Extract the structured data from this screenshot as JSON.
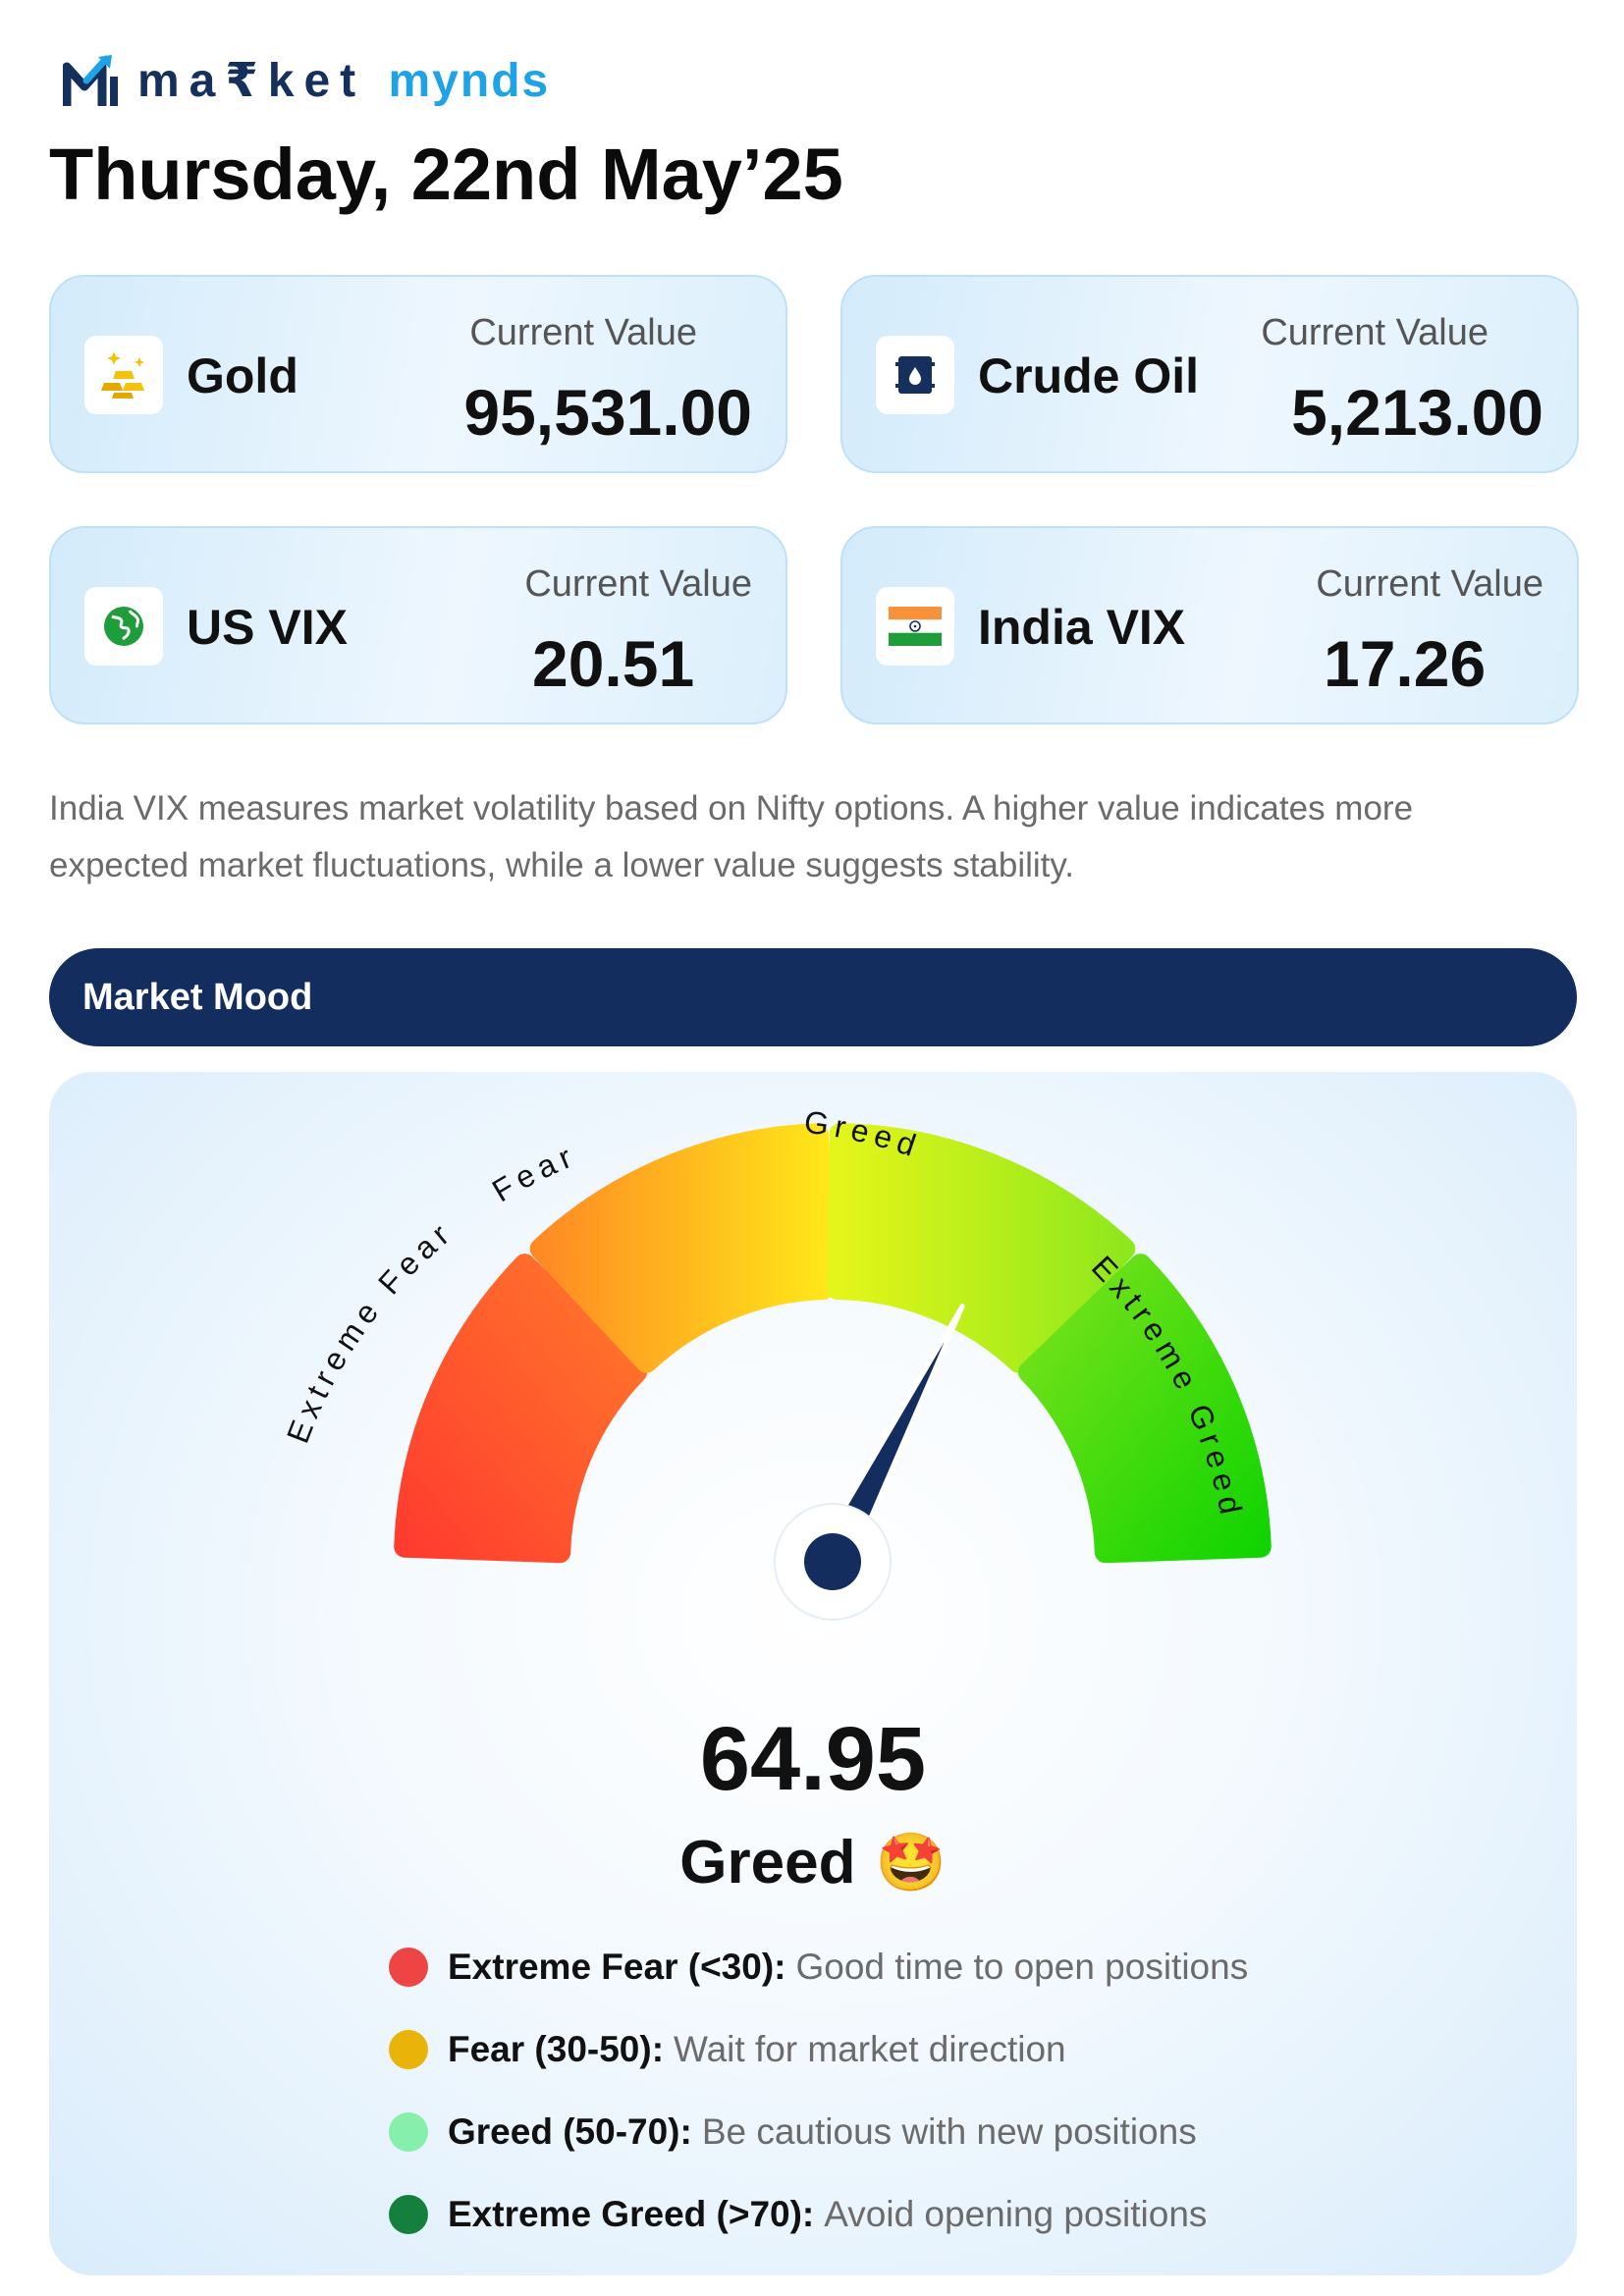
{
  "brand": {
    "name_part1": "marketmy",
    "name_part1_display": "ma₹ket",
    "name_part2": "mynds",
    "colors": {
      "navy": "#16305e",
      "sky": "#1fa3e6"
    }
  },
  "date_title": "Thursday, 22nd May’25",
  "cards": [
    {
      "name": "Gold",
      "value_label": "Current Value",
      "value": "95,531.00",
      "icon": "gold-bars-icon"
    },
    {
      "name": "Crude Oil",
      "value_label": "Current Value",
      "value": "5,213.00",
      "icon": "oil-barrel-icon"
    },
    {
      "name": "US VIX",
      "value_label": "Current Value",
      "value": "20.51",
      "icon": "globe-icon"
    },
    {
      "name": "India VIX",
      "value_label": "Current Value",
      "value": "17.26",
      "icon": "india-flag-icon"
    }
  ],
  "description": "India VIX measures market volatility based on Nifty options. A higher value indicates more expected market fluctuations, while a lower value suggests stability.",
  "mood": {
    "section_title": "Market Mood",
    "score": "64.95",
    "score_value": 64.95,
    "label": "Greed",
    "emoji": "🤩",
    "gauge_labels": [
      "Extreme Fear",
      "Fear",
      "Greed",
      "Extreme Greed"
    ],
    "legend": [
      {
        "label": "Extreme Fear (<30):",
        "text": "Good time to open positions",
        "color": "#ef4444"
      },
      {
        "label": "Fear (30-50):",
        "text": "Wait for market direction",
        "color": "#eab308"
      },
      {
        "label": "Greed (50-70):",
        "text": "Be cautious with new positions",
        "color": "#86efac"
      },
      {
        "label": "Extreme Greed (>70):",
        "text": "Avoid opening positions",
        "color": "#15803d"
      }
    ]
  }
}
